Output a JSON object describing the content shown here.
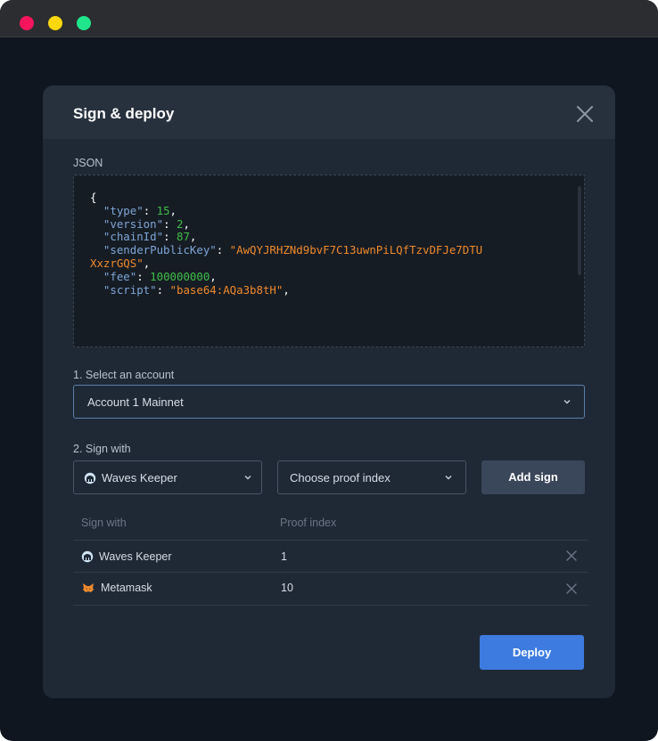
{
  "dialog": {
    "title": "Sign & deploy"
  },
  "json_section": {
    "label": "JSON",
    "code": {
      "open_brace": "{",
      "type_key": "\"type\"",
      "type_val": "15",
      "version_key": "\"version\"",
      "version_val": "2",
      "chainid_key": "\"chainId\"",
      "chainid_val": "87",
      "senderpk_key": "\"senderPublicKey\"",
      "senderpk_val_1": "\"AwQYJRHZNd9bvF7C13uwnPiLQfTzvDFJe7DTU",
      "senderpk_val_2": "XxzrGQS\"",
      "fee_key": "\"fee\"",
      "fee_val": "100000000",
      "script_key": "\"script\"",
      "script_val": "\"base64:AQa3b8tH\""
    }
  },
  "account": {
    "label": "1. Select an account",
    "selected": "Account 1 Mainnet"
  },
  "sign": {
    "label": "2. Sign with",
    "signer_selected": "Waves Keeper",
    "proof_placeholder": "Choose proof index",
    "add_button": "Add sign"
  },
  "signatures_table": {
    "headers": [
      "Sign with",
      "Proof index"
    ],
    "rows": [
      {
        "signer": "Waves Keeper",
        "icon": "waves-keeper-icon",
        "proof_index": "1"
      },
      {
        "signer": "Metamask",
        "icon": "metamask-icon",
        "proof_index": "10"
      }
    ]
  },
  "deploy_button": "Deploy",
  "colors": {
    "accent": "#3d7be0",
    "json_key": "#7ea6d8",
    "json_number": "#3fbf48",
    "json_string": "#ef8a2c"
  }
}
